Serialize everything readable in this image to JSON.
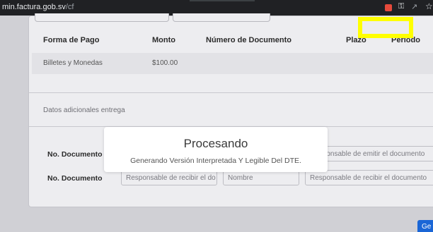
{
  "browser": {
    "url_host": "min.factura.gob.sv",
    "url_path": "/cf",
    "icons": [
      "extension-icon",
      "key-icon",
      "share-icon",
      "star-icon"
    ]
  },
  "payment_table": {
    "headers": [
      "Forma de Pago",
      "Monto",
      "Número de Documento",
      "Plazo",
      "Periodo"
    ],
    "rows": [
      [
        "Billetes y Monedas",
        "$100.00"
      ]
    ]
  },
  "delivery": {
    "title": "Datos adicionales entrega",
    "rows": [
      {
        "label": "No. Documento",
        "placeholder_left": "",
        "placeholder_mid": "",
        "placeholder_right": "Responsable de emitir el documento"
      },
      {
        "label": "No. Documento",
        "placeholder_left": "Responsable de recibir el do",
        "placeholder_mid": "Nombre",
        "placeholder_right": "Responsable de recibir el documento"
      }
    ]
  },
  "modal": {
    "title": "Procesando",
    "message": "Generando Versión Interpretada Y Legible Del DTE."
  },
  "save_button": {
    "label": "Ge"
  },
  "colors": {
    "highlight": "#ffff00",
    "primary_button": "#1a66d6"
  }
}
